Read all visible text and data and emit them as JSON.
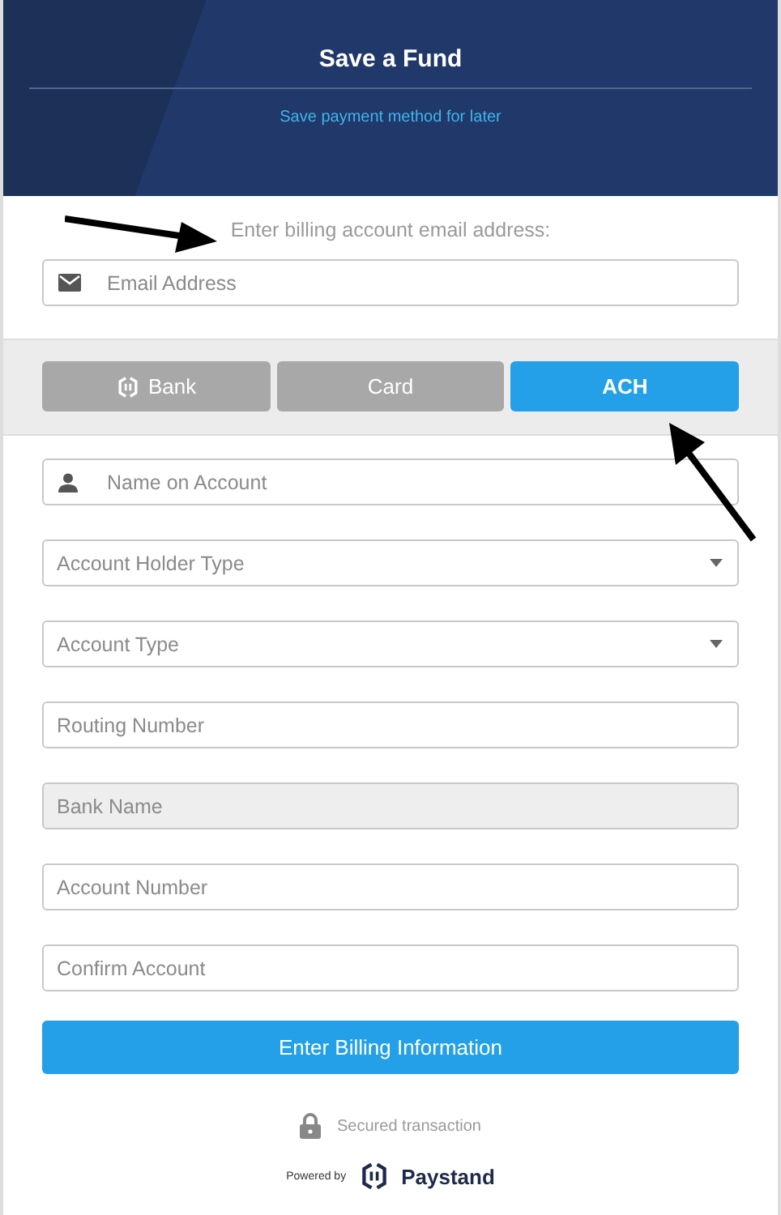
{
  "header": {
    "title": "Save a Fund",
    "subtitle": "Save payment method for later"
  },
  "email": {
    "label": "Enter billing account email address:",
    "placeholder": "Email Address"
  },
  "tabs": [
    {
      "label": "Bank",
      "kind": "with_icon",
      "selected": false
    },
    {
      "label": "Card",
      "kind": "plain",
      "selected": false
    },
    {
      "label": "ACH",
      "kind": "plain",
      "selected": true
    }
  ],
  "fields": [
    {
      "placeholder": "Name on Account",
      "kind": "with_icon",
      "disabled": false
    },
    {
      "placeholder": "Account Holder Type",
      "kind": "select",
      "disabled": false
    },
    {
      "placeholder": "Account Type",
      "kind": "select",
      "disabled": false
    },
    {
      "placeholder": "Routing Number",
      "kind": "text",
      "disabled": false
    },
    {
      "placeholder": "Bank Name",
      "kind": "text",
      "disabled": true
    },
    {
      "placeholder": "Account Number",
      "kind": "text",
      "disabled": false
    },
    {
      "placeholder": "Confirm Account",
      "kind": "text",
      "disabled": false
    }
  ],
  "submit": "Enter Billing Information",
  "footer": {
    "secured": "Secured transaction",
    "powered_by": "Powered by",
    "brand": "Paystand"
  }
}
